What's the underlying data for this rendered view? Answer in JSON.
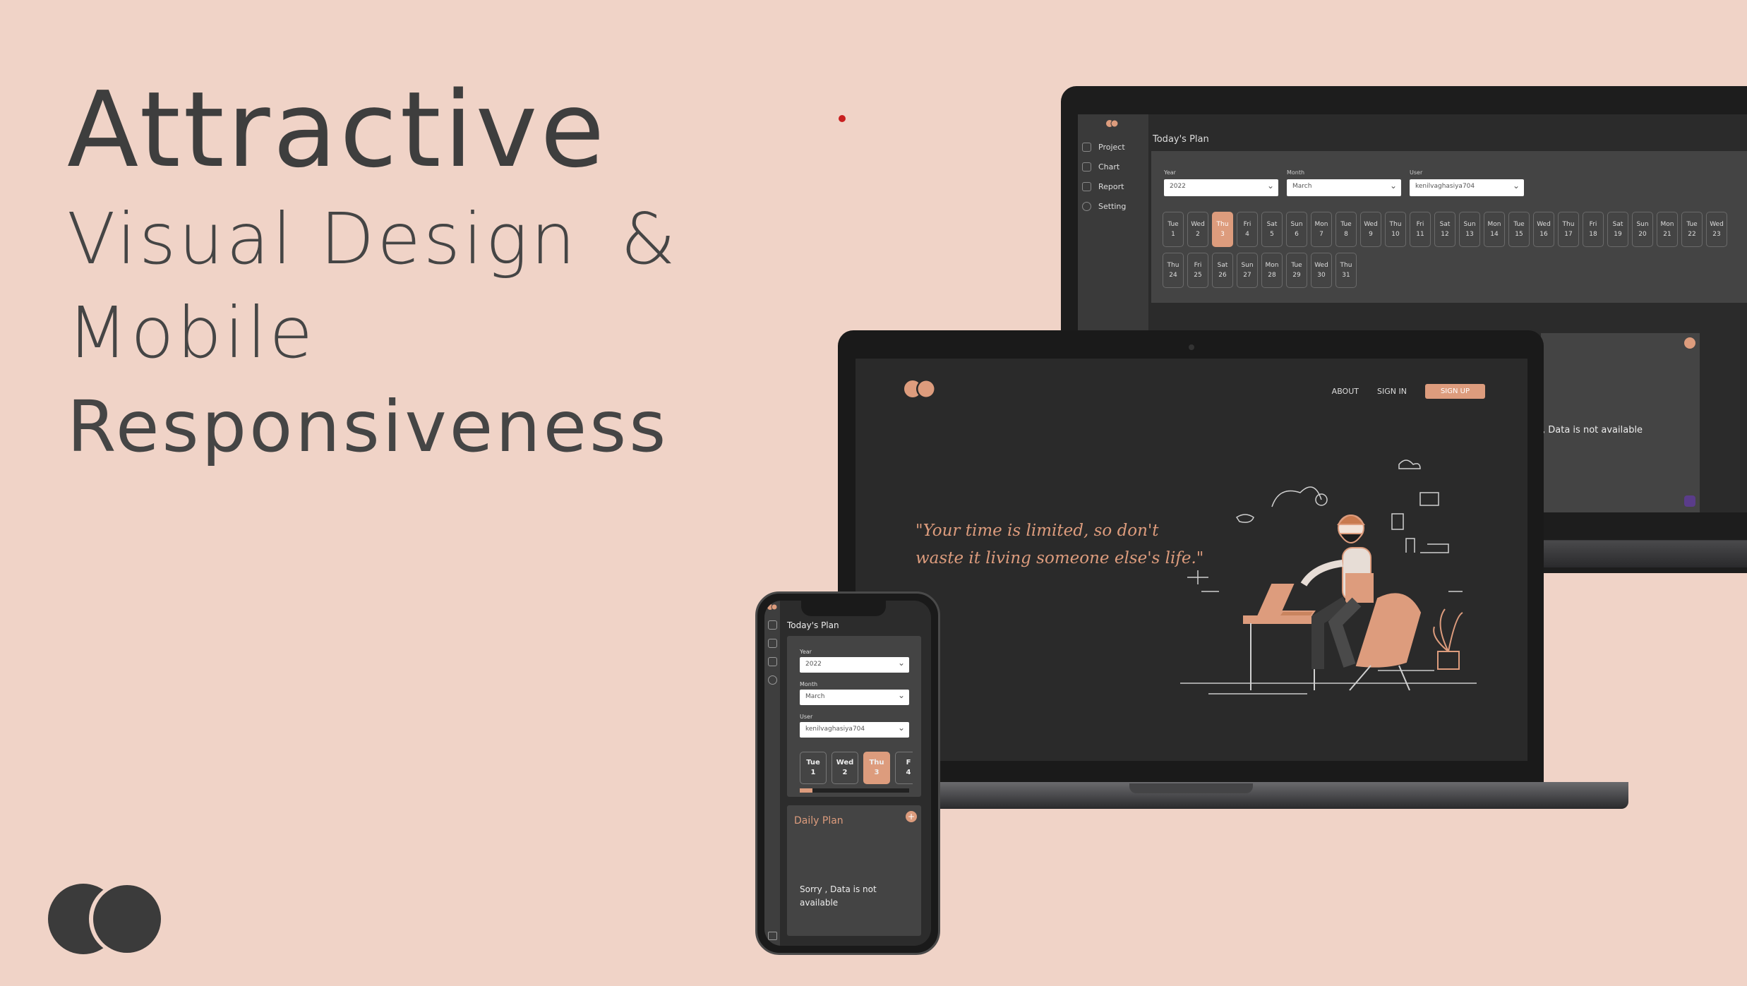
{
  "hero": {
    "line1": "Attractive",
    "line2": "Visual Design",
    "ampersand": "&",
    "line3": "Mobile",
    "line4": "Responsiveness"
  },
  "colors": {
    "background": "#f0d3c7",
    "accent": "#dd9c7d",
    "dark": "#2b2b2b",
    "text": "#3e3e3e"
  },
  "dashboard": {
    "sidebar": [
      {
        "label": "Project",
        "icon": "layers-icon"
      },
      {
        "label": "Chart",
        "icon": "chart-icon"
      },
      {
        "label": "Report",
        "icon": "report-icon"
      },
      {
        "label": "Setting",
        "icon": "gear-icon"
      }
    ],
    "title": "Today's Plan",
    "year_label": "Year",
    "year_value": "2022",
    "month_label": "Month",
    "month_value": "March",
    "user_label": "User",
    "user_value": "kenilvaghasiya704",
    "days_row1": [
      {
        "d": "Tue",
        "n": "1"
      },
      {
        "d": "Wed",
        "n": "2"
      },
      {
        "d": "Thu",
        "n": "3",
        "active": true
      },
      {
        "d": "Fri",
        "n": "4"
      },
      {
        "d": "Sat",
        "n": "5"
      },
      {
        "d": "Sun",
        "n": "6"
      },
      {
        "d": "Mon",
        "n": "7"
      },
      {
        "d": "Tue",
        "n": "8"
      },
      {
        "d": "Wed",
        "n": "9"
      },
      {
        "d": "Thu",
        "n": "10"
      },
      {
        "d": "Fri",
        "n": "11"
      },
      {
        "d": "Sat",
        "n": "12"
      },
      {
        "d": "Sun",
        "n": "13"
      },
      {
        "d": "Mon",
        "n": "14"
      },
      {
        "d": "Tue",
        "n": "15"
      },
      {
        "d": "Wed",
        "n": "16"
      },
      {
        "d": "Thu",
        "n": "17"
      },
      {
        "d": "Fri",
        "n": "18"
      },
      {
        "d": "Sat",
        "n": "19"
      },
      {
        "d": "Sun",
        "n": "20"
      },
      {
        "d": "Mon",
        "n": "21"
      },
      {
        "d": "Tue",
        "n": "22"
      },
      {
        "d": "Wed",
        "n": "23"
      }
    ],
    "days_row2": [
      {
        "d": "Thu",
        "n": "24"
      },
      {
        "d": "Fri",
        "n": "25"
      },
      {
        "d": "Sat",
        "n": "26"
      },
      {
        "d": "Sun",
        "n": "27"
      },
      {
        "d": "Mon",
        "n": "28"
      },
      {
        "d": "Tue",
        "n": "29"
      },
      {
        "d": "Wed",
        "n": "30"
      },
      {
        "d": "Thu",
        "n": "31"
      }
    ],
    "lower_message": ", Data is not available"
  },
  "landing": {
    "nav_about": "ABOUT",
    "nav_signin": "SIGN IN",
    "nav_signup": "SIGN UP",
    "quote_line1": "\"Your time is limited, so don't",
    "quote_line2": "waste it living someone else's life.\""
  },
  "phone": {
    "title": "Today's Plan",
    "year_label": "Year",
    "year_value": "2022",
    "month_label": "Month",
    "month_value": "March",
    "user_label": "User",
    "user_value": "kenilvaghasiya704",
    "days": [
      {
        "d": "Tue",
        "n": "1"
      },
      {
        "d": "Wed",
        "n": "2"
      },
      {
        "d": "Thu",
        "n": "3",
        "active": true
      },
      {
        "d": "F",
        "n": "4"
      }
    ],
    "daily_title": "Daily Plan",
    "add_symbol": "+",
    "empty_message": "Sorry , Data is not available"
  }
}
